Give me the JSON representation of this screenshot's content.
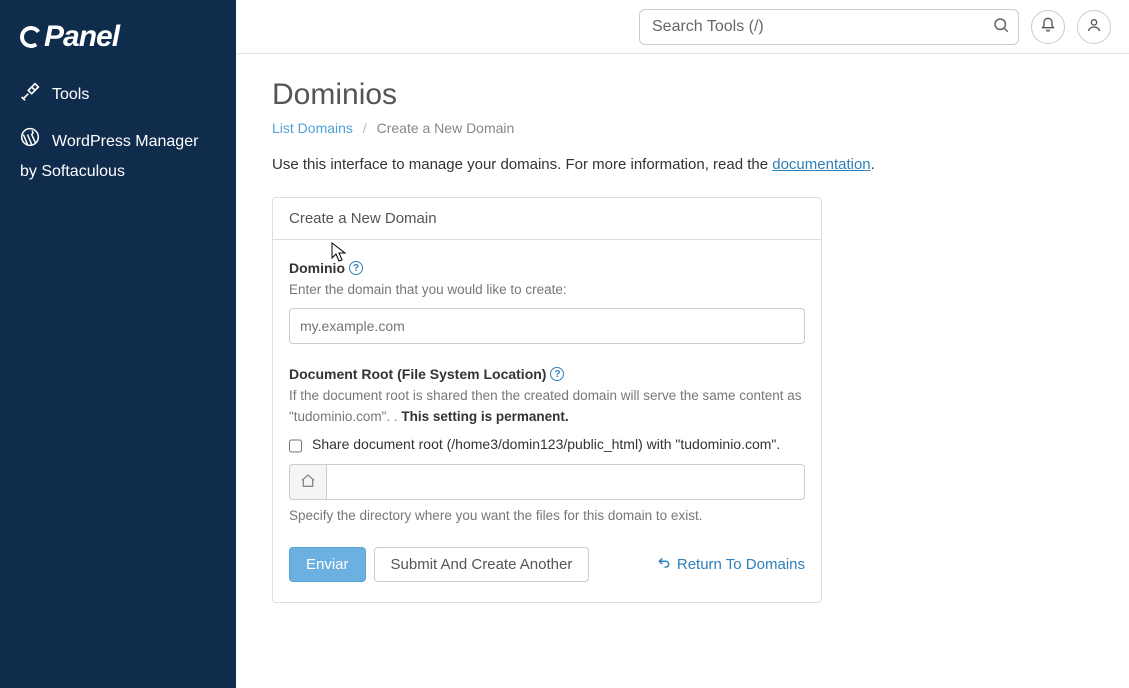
{
  "sidebar": {
    "logo_text": "Panel",
    "items": [
      {
        "label": "Tools"
      },
      {
        "label1": "WordPress Manager",
        "label2": "by Softaculous"
      }
    ]
  },
  "topbar": {
    "search_placeholder": "Search Tools (/)"
  },
  "page": {
    "title": "Dominios",
    "breadcrumb": {
      "parent": "List Domains",
      "current": "Create a New Domain"
    },
    "intro_text": "Use this interface to manage your domains. For more information, read the ",
    "intro_link": "documentation",
    "intro_period": "."
  },
  "card": {
    "header": "Create a New Domain",
    "domain": {
      "label": "Dominio",
      "sub": "Enter the domain that you would like to create:",
      "placeholder": "my.example.com",
      "value": ""
    },
    "docroot": {
      "label": "Document Root (File System Location)",
      "sub_a": "If the document root is shared then the created domain will serve the same content as \"tudominio.com\".     . ",
      "sub_b": "This setting is permanent.",
      "checkbox_label": "Share document root (/home3/domin123/public_html) with \"tudominio.com\".",
      "value": "",
      "help": "Specify the directory where you want the files for this domain to exist."
    },
    "actions": {
      "submit": "Enviar",
      "submit_another": "Submit And Create Another",
      "return": "Return To Domains"
    }
  }
}
